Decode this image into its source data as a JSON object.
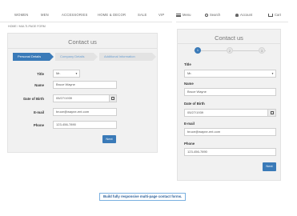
{
  "desktop": {
    "nav": [
      "WOMEN",
      "MEN",
      "ACCESSORIES",
      "HOME & DECOR",
      "SALE",
      "VIP"
    ],
    "breadcrumb": "HOME  /  MULTI-PAGE FORM",
    "form_title": "Contact us",
    "steps": [
      "Personal Details",
      "Company Details",
      "Additional Information"
    ],
    "fields": {
      "title_label": "Title",
      "title_value": "Mr.",
      "name_label": "Name",
      "name_value": "Bruce Wayne",
      "dob_label": "Date of Birth",
      "dob_value": "05/27/1939",
      "email_label": "E-mail",
      "email_value": "bruce@wayne-ent.com",
      "phone_label": "Phone",
      "phone_value": "123-456-7890"
    },
    "next_label": "Next"
  },
  "mobile": {
    "header": {
      "menu": "Menu",
      "search": "Search",
      "account": "Account",
      "cart": "Cart"
    },
    "form_title": "Contact us",
    "steps": [
      "1",
      "2",
      "3"
    ],
    "fields": {
      "title_label": "Title",
      "title_value": "Mr.",
      "name_label": "Name",
      "name_value": "Bruce Wayne",
      "dob_label": "Date of Birth",
      "dob_value": "05/27/1939",
      "email_label": "E-mail",
      "email_value": "bruce@wayne-ent.com",
      "phone_label": "Phone",
      "phone_value": "123-456-7890"
    },
    "next_label": "Next"
  },
  "caption": "Build fully responsive multi-page contact forms.",
  "colors": {
    "accent": "#3a7ab8",
    "panel": "#f1f1f1",
    "link": "#6a9fd3"
  }
}
